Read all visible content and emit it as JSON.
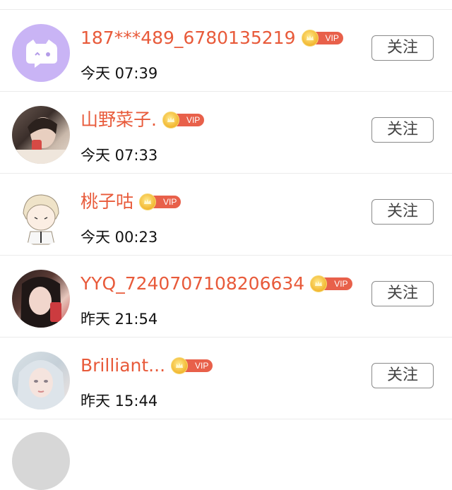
{
  "rows": [
    {
      "name": "187***489_6780135219",
      "vip": "VIP",
      "time": "今天 07:39",
      "follow": "关注",
      "avatar": "chat-bubble-avatar"
    },
    {
      "name": "山野菜子.",
      "vip": "VIP",
      "time": "今天 07:33",
      "follow": "关注",
      "avatar": "photo-avatar"
    },
    {
      "name": "桃子咕",
      "vip": "VIP",
      "time": "今天 00:23",
      "follow": "关注",
      "avatar": "cartoon-avatar"
    },
    {
      "name": "YYQ_7240707108206634",
      "vip": "VIP",
      "time": "昨天 21:54",
      "follow": "关注",
      "avatar": "photo-avatar"
    },
    {
      "name": "Brilliant...",
      "vip": "VIP",
      "time": "昨天 15:44",
      "follow": "关注",
      "avatar": "photo-avatar"
    }
  ],
  "colors": {
    "name": "#e85a3a",
    "vip_pill": "#e8604a",
    "crown": "#f2b630",
    "purple_avatar": "#c9b4f5"
  }
}
